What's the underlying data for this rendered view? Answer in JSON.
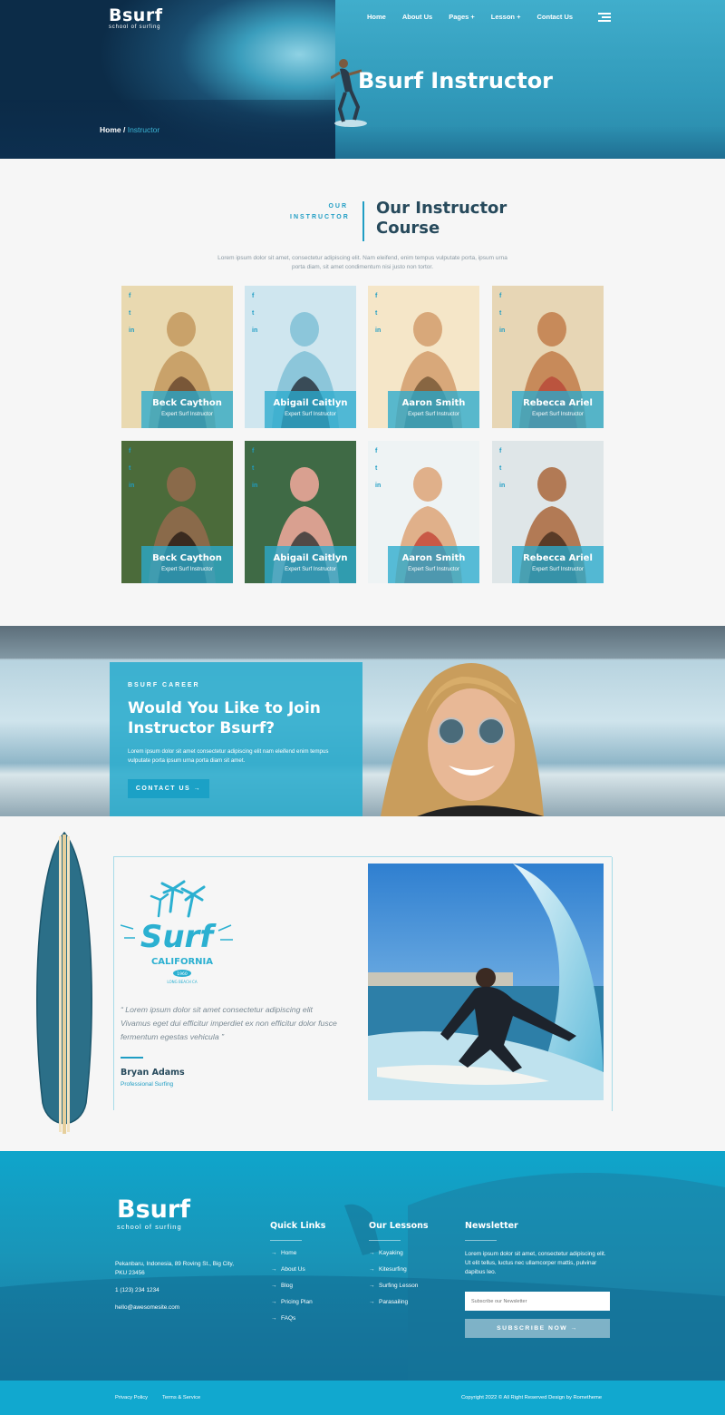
{
  "brand": {
    "name": "Bsurf",
    "tagline": "school of surfing"
  },
  "nav": {
    "items": [
      "Home",
      "About Us",
      "Pages +",
      "Lesson +",
      "Contact Us"
    ]
  },
  "hero": {
    "title": "Bsurf Instructor",
    "breadcrumb": {
      "home": "Home",
      "separator": " / ",
      "current": "Instructor"
    }
  },
  "instructors": {
    "eyebrow": "OUR\nINSTRUCTOR",
    "title": "Our Instructor Course",
    "description": "Lorem ipsum dolor sit amet, consectetur adipiscing elit. Nam eleifend, enim tempus vulputate porta, ipsum urna porta diam, sit amet condimentum nisi justo non tortor.",
    "socials": [
      "f",
      "t",
      "in"
    ],
    "cards": [
      {
        "name": "Beck Caython",
        "role": "Expert Surf Instructor"
      },
      {
        "name": "Abigail Caitlyn",
        "role": "Expert Surf Instructor"
      },
      {
        "name": "Aaron Smith",
        "role": "Expert Surf Instructor"
      },
      {
        "name": "Rebecca Ariel",
        "role": "Expert Surf Instructor"
      },
      {
        "name": "Beck Caython",
        "role": "Expert Surf Instructor"
      },
      {
        "name": "Abigail Caitlyn",
        "role": "Expert Surf Instructor"
      },
      {
        "name": "Aaron Smith",
        "role": "Expert Surf Instructor"
      },
      {
        "name": "Rebecca Ariel",
        "role": "Expert Surf Instructor"
      }
    ]
  },
  "career": {
    "eyebrow": "BSURF CAREER",
    "title": "Would You Like to Join Instructor Bsurf?",
    "description": "Lorem ipsum dolor sit amet consectetur adipiscing elit nam eleifend enim tempus vulputate porta ipsum urna porta diam sit amet.",
    "button": "CONTACT US →"
  },
  "testimonial": {
    "logo_text": {
      "main": "Surf",
      "sub": "CALIFORNIA",
      "badge": "1960",
      "small": "LONG BEACH CA"
    },
    "quote": "“ Lorem ipsum dolor sit amet consectetur adipiscing elit Vivamus eget dui efficitur imperdiet ex non efficitur dolor fusce fermentum egestas vehicula ”",
    "name": "Bryan Adams",
    "role": "Professional Surfing"
  },
  "footer": {
    "brand": {
      "name": "Bsurf",
      "tagline": "school of surfing"
    },
    "address": "Pekanbaru, Indonesia, 89 Roving St., Big City, PKU 23456",
    "phone": "1 (123) 234 1234",
    "email": "hello@awesomesite.com",
    "quick_links": {
      "title": "Quick Links",
      "items": [
        "Home",
        "About Us",
        "Blog",
        "Pricing Plan",
        "FAQs"
      ]
    },
    "lessons": {
      "title": "Our Lessons",
      "items": [
        "Kayaking",
        "Kitesurfing",
        "Surfing Lesson",
        "Parasailing"
      ]
    },
    "newsletter": {
      "title": "Newsletter",
      "text": "Lorem ipsum dolor sit amet, consectetur adipiscing elit. Ut elit tellus, luctus nec ullamcorper mattis, pulvinar dapibus leo.",
      "placeholder": "Subscribe our Newsletter",
      "button": "SUBSCRIBE NOW →"
    },
    "bottom": {
      "privacy": "Privacy Policy",
      "terms": "Terms & Service",
      "copyright": "Copyright 2022 © All Right Reserved Design by Rometheme"
    }
  },
  "colors": {
    "accent": "#1f9dc4",
    "heading": "#274a5c",
    "footer": "#0fa5cb",
    "background": "#f6f6f6"
  }
}
